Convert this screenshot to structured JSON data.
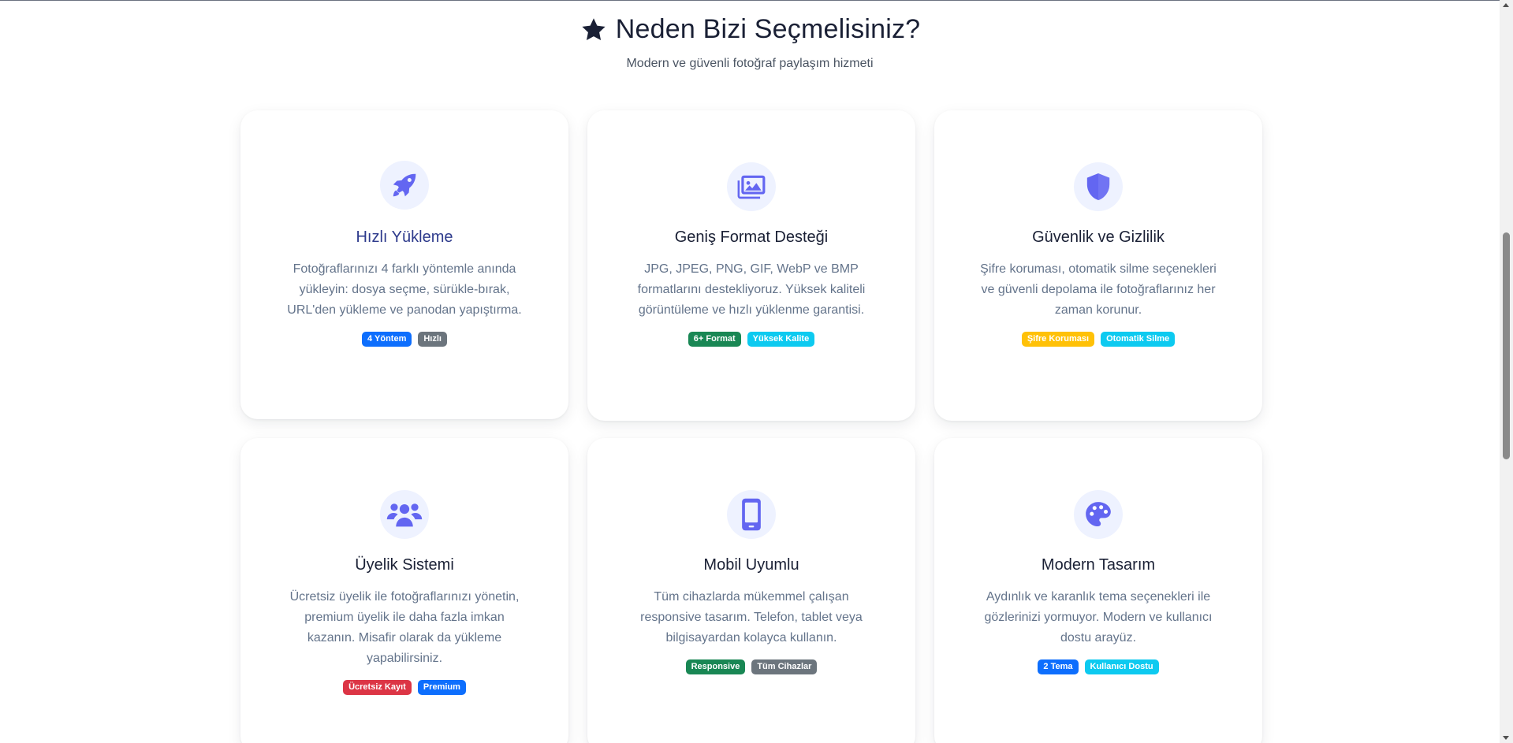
{
  "section": {
    "title": "Neden Bizi Seçmelisiniz?",
    "subtitle": "Modern ve güvenli fotoğraf paylaşım hizmeti",
    "title_icon": "star-icon"
  },
  "colors": {
    "accent_icon": "#6366f1",
    "icon_bg": "#eef2ff",
    "badge_primary": "#0d6efd",
    "badge_secondary": "#6c757d",
    "badge_success": "#198754",
    "badge_info": "#0dcaf0",
    "badge_warning": "#ffc107",
    "badge_danger": "#dc3545"
  },
  "features": [
    {
      "icon": "rocket-icon",
      "title": "Hızlı Yükleme",
      "description": "Fotoğraflarınızı 4 farklı yöntemle anında yükleyin: dosya seçme, sürükle-bırak, URL'den yükleme ve panodan yapıştırma.",
      "badges": [
        {
          "label": "4 Yöntem",
          "color": "#0d6efd"
        },
        {
          "label": "Hızlı",
          "color": "#6c757d"
        }
      ]
    },
    {
      "icon": "images-icon",
      "title": "Geniş Format Desteği",
      "description": "JPG, JPEG, PNG, GIF, WebP ve BMP formatlarını destekliyoruz. Yüksek kaliteli görüntüleme ve hızlı yüklenme garantisi.",
      "badges": [
        {
          "label": "6+ Format",
          "color": "#198754"
        },
        {
          "label": "Yüksek Kalite",
          "color": "#0dcaf0"
        }
      ]
    },
    {
      "icon": "shield-icon",
      "title": "Güvenlik ve Gizlilik",
      "description": "Şifre koruması, otomatik silme seçenekleri ve güvenli depolama ile fotoğraflarınız her zaman korunur.",
      "badges": [
        {
          "label": "Şifre Koruması",
          "color": "#ffc107"
        },
        {
          "label": "Otomatik Silme",
          "color": "#0dcaf0"
        }
      ]
    },
    {
      "icon": "users-icon",
      "title": "Üyelik Sistemi",
      "description": "Ücretsiz üyelik ile fotoğraflarınızı yönetin, premium üyelik ile daha fazla imkan kazanın. Misafir olarak da yükleme yapabilirsiniz.",
      "badges": [
        {
          "label": "Ücretsiz Kayıt",
          "color": "#dc3545"
        },
        {
          "label": "Premium",
          "color": "#0d6efd"
        }
      ]
    },
    {
      "icon": "mobile-icon",
      "title": "Mobil Uyumlu",
      "description": "Tüm cihazlarda mükemmel çalışan responsive tasarım. Telefon, tablet veya bilgisayardan kolayca kullanın.",
      "badges": [
        {
          "label": "Responsive",
          "color": "#198754"
        },
        {
          "label": "Tüm Cihazlar",
          "color": "#6c757d"
        }
      ]
    },
    {
      "icon": "palette-icon",
      "title": "Modern Tasarım",
      "description": "Aydınlık ve karanlık tema seçenekleri ile gözlerinizi yormuyor. Modern ve kullanıcı dostu arayüz.",
      "badges": [
        {
          "label": "2 Tema",
          "color": "#0d6efd"
        },
        {
          "label": "Kullanıcı Dostu",
          "color": "#0dcaf0"
        }
      ]
    }
  ]
}
